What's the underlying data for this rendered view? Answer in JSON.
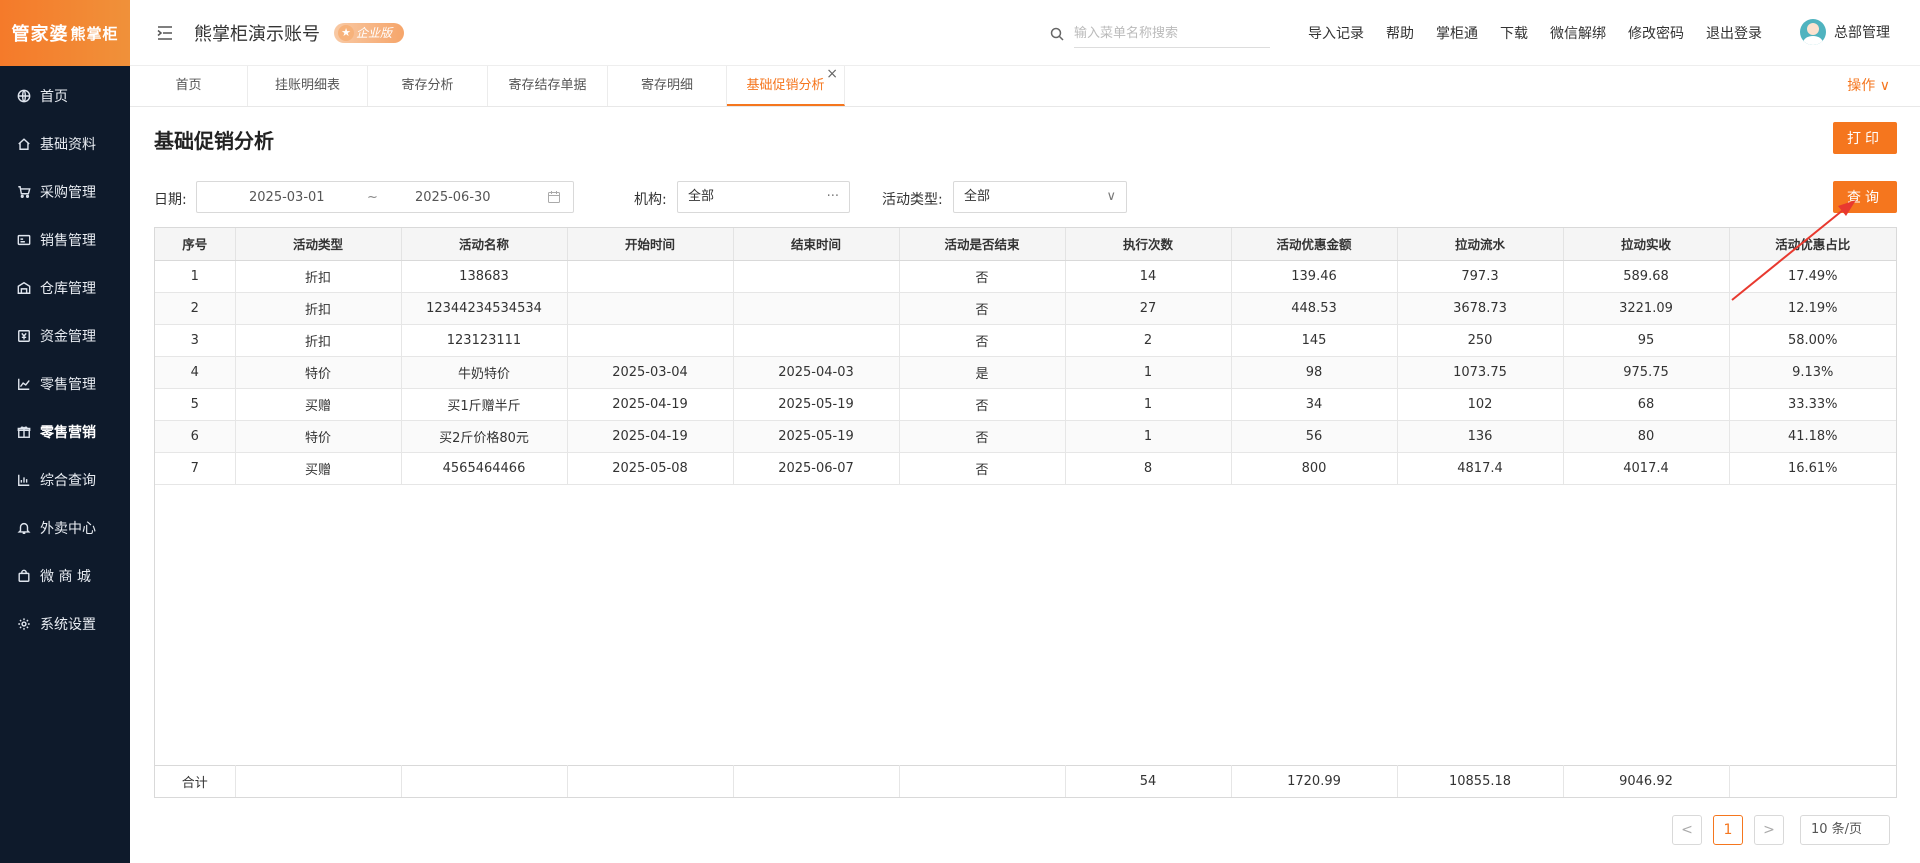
{
  "sidebar": {
    "logo": "管家婆",
    "logo_sub": "熊掌柜",
    "items": [
      {
        "label": "首页",
        "icon": "globe-icon"
      },
      {
        "label": "基础资料",
        "icon": "home-icon"
      },
      {
        "label": "采购管理",
        "icon": "cart-icon"
      },
      {
        "label": "销售管理",
        "icon": "sales-icon"
      },
      {
        "label": "仓库管理",
        "icon": "warehouse-icon"
      },
      {
        "label": "资金管理",
        "icon": "money-icon"
      },
      {
        "label": "零售管理",
        "icon": "chart-icon"
      },
      {
        "label": "零售营销",
        "icon": "gift-icon"
      },
      {
        "label": "综合查询",
        "icon": "bar-chart-icon"
      },
      {
        "label": "外卖中心",
        "icon": "bell-icon"
      },
      {
        "label": "微 商 城",
        "icon": "bag-icon"
      },
      {
        "label": "系统设置",
        "icon": "gear-icon"
      }
    ]
  },
  "header": {
    "title": "熊掌柜演示账号",
    "badge": "企业版",
    "search_placeholder": "输入菜单名称搜索",
    "links": [
      "导入记录",
      "帮助",
      "掌柜通",
      "下载",
      "微信解绑",
      "修改密码",
      "退出登录"
    ],
    "user": "总部管理"
  },
  "tabs": {
    "items": [
      "首页",
      "挂账明细表",
      "寄存分析",
      "寄存结存单据",
      "寄存明细",
      "基础促销分析"
    ],
    "close": "×",
    "op": "操作 ∨"
  },
  "page": {
    "title": "基础促销分析",
    "print": "打印",
    "query": "查询",
    "filters": {
      "date_label": "日期:",
      "date_start": "2025-03-01",
      "date_sep": "~",
      "date_end": "2025-06-30",
      "org_label": "机构:",
      "org_value": "全部",
      "org_suffix": "···",
      "type_label": "活动类型:",
      "type_value": "全部",
      "type_suffix": "∨"
    }
  },
  "table": {
    "headers": [
      "序号",
      "活动类型",
      "活动名称",
      "开始时间",
      "结束时间",
      "活动是否结束",
      "执行次数",
      "活动优惠金额",
      "拉动流水",
      "拉动实收",
      "活动优惠占比"
    ],
    "rows": [
      [
        "1",
        "折扣",
        "138683",
        "",
        "",
        "否",
        "14",
        "139.46",
        "797.3",
        "589.68",
        "17.49%"
      ],
      [
        "2",
        "折扣",
        "12344234534534",
        "",
        "",
        "否",
        "27",
        "448.53",
        "3678.73",
        "3221.09",
        "12.19%"
      ],
      [
        "3",
        "折扣",
        "123123111",
        "",
        "",
        "否",
        "2",
        "145",
        "250",
        "95",
        "58.00%"
      ],
      [
        "4",
        "特价",
        "牛奶特价",
        "2025-03-04",
        "2025-04-03",
        "是",
        "1",
        "98",
        "1073.75",
        "975.75",
        "9.13%"
      ],
      [
        "5",
        "买赠",
        "买1斤赠半斤",
        "2025-04-19",
        "2025-05-19",
        "否",
        "1",
        "34",
        "102",
        "68",
        "33.33%"
      ],
      [
        "6",
        "特价",
        "买2斤价格80元",
        "2025-04-19",
        "2025-05-19",
        "否",
        "1",
        "56",
        "136",
        "80",
        "41.18%"
      ],
      [
        "7",
        "买赠",
        "4565464466",
        "2025-05-08",
        "2025-06-07",
        "否",
        "8",
        "800",
        "4817.4",
        "4017.4",
        "16.61%"
      ]
    ],
    "footer": [
      "合计",
      "",
      "",
      "",
      "",
      "",
      "54",
      "1720.99",
      "10855.18",
      "9046.92",
      ""
    ]
  },
  "pager": {
    "prev": "<",
    "current": "1",
    "next": ">",
    "size": "10 条/页"
  },
  "colors": {
    "accent": "#f5761e",
    "sidebar": "#0e1a2b"
  }
}
